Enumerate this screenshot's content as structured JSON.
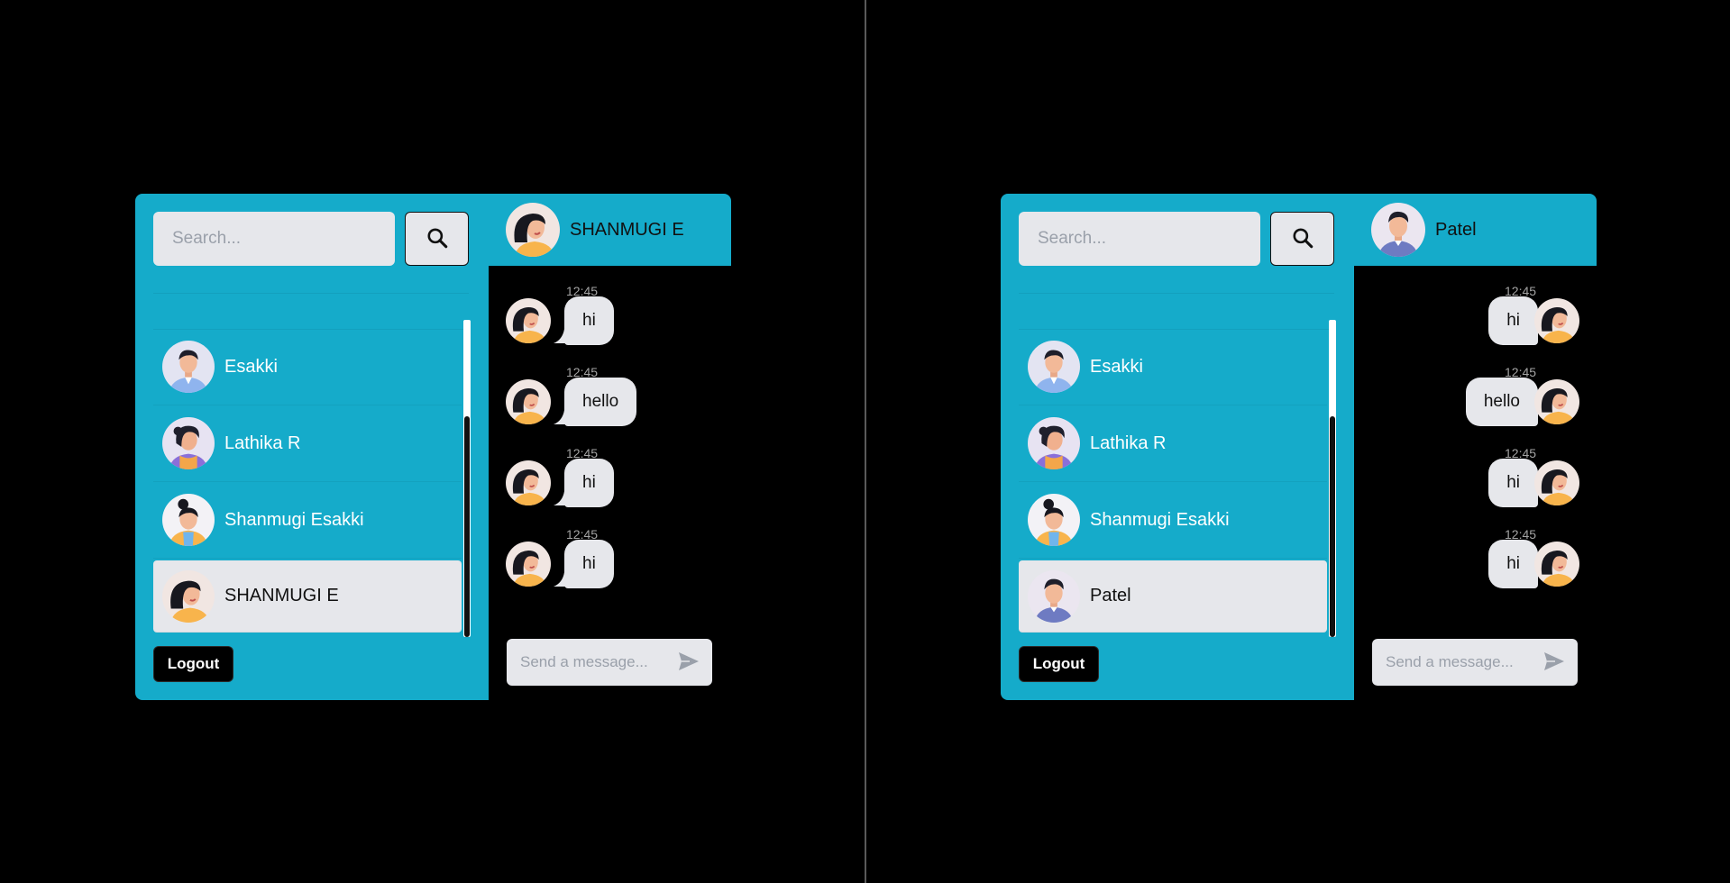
{
  "colors": {
    "accent": "#15abca",
    "panel_bg": "#000000",
    "input_bg": "#e6e7eb",
    "bubble_bg": "#e6e7eb",
    "time_text": "#a3a3a3"
  },
  "windows": [
    {
      "search": {
        "placeholder": "Search...",
        "button_icon": "search-icon"
      },
      "chat_list": [
        {
          "name": "Esakki",
          "avatar": "man-avatar-blue-shirt"
        },
        {
          "name": "Lathika R",
          "avatar": "woman-avatar-purple-shirt"
        },
        {
          "name": "Shanmugi Esakki",
          "avatar": "woman-avatar-bun"
        },
        {
          "name": "SHANMUGI E",
          "avatar": "woman-avatar-orange-shirt",
          "selected": true
        }
      ],
      "logout_label": "Logout",
      "header": {
        "name": "SHANMUGI E",
        "avatar": "woman-avatar-orange-shirt"
      },
      "messages": [
        {
          "time": "12:45",
          "text": "hi",
          "side": "incoming"
        },
        {
          "time": "12:45",
          "text": "hello",
          "side": "incoming"
        },
        {
          "time": "12:45",
          "text": "hi",
          "side": "incoming"
        },
        {
          "time": "12:45",
          "text": "hi",
          "side": "incoming"
        }
      ],
      "composer": {
        "placeholder": "Send a message...",
        "send_icon": "send-icon"
      }
    },
    {
      "search": {
        "placeholder": "Search...",
        "button_icon": "search-icon"
      },
      "chat_list": [
        {
          "name": "Esakki",
          "avatar": "man-avatar-blue-shirt"
        },
        {
          "name": "Lathika R",
          "avatar": "woman-avatar-purple-shirt"
        },
        {
          "name": "Shanmugi Esakki",
          "avatar": "woman-avatar-bun"
        },
        {
          "name": "Patel",
          "avatar": "man-avatar-purple-shirt",
          "selected": true
        }
      ],
      "logout_label": "Logout",
      "header": {
        "name": "Patel",
        "avatar": "man-avatar-purple-shirt"
      },
      "messages": [
        {
          "time": "12:45",
          "text": "hi",
          "side": "outgoing"
        },
        {
          "time": "12:45",
          "text": "hello",
          "side": "outgoing"
        },
        {
          "time": "12:45",
          "text": "hi",
          "side": "outgoing"
        },
        {
          "time": "12:45",
          "text": "hi",
          "side": "outgoing"
        }
      ],
      "composer": {
        "placeholder": "Send a message...",
        "send_icon": "send-icon"
      }
    }
  ]
}
